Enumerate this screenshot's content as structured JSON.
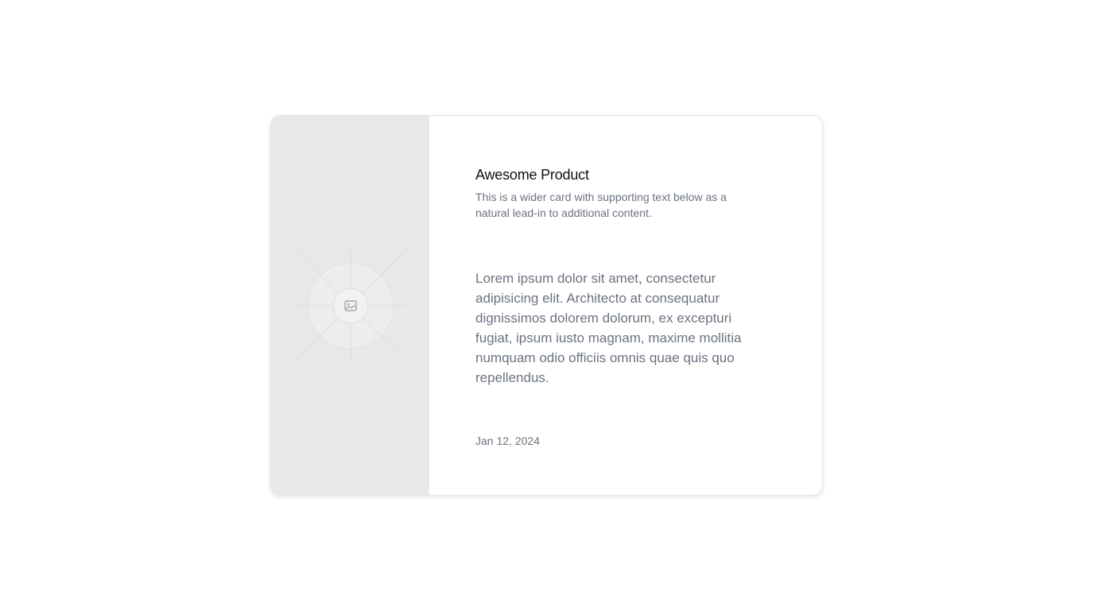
{
  "card": {
    "title": "Awesome Product",
    "subtitle": "This is a wider card with supporting text below as a natural lead-in to additional content.",
    "body": "Lorem ipsum dolor sit amet, consectetur adipisicing elit. Architecto at consequatur dignissimos dolorem dolorum, ex excepturi fugiat, ipsum iusto magnam, maxime mollitia numquam odio officiis omnis quae quis quo repellendus.",
    "date": "Jan 12, 2024",
    "image_icon": "image-icon"
  },
  "colors": {
    "media_background": "#e8e8e8",
    "text_muted": "#6b7280",
    "title": "#111111"
  }
}
